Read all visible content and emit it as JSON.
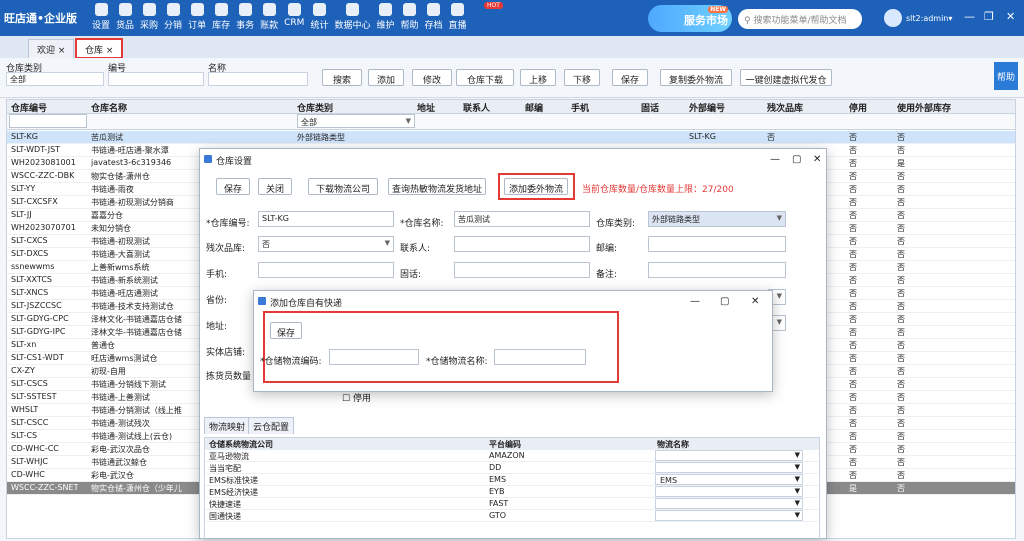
{
  "app": {
    "logo": "旺店通•企业版",
    "hot_badge": "HOT",
    "service": {
      "text": "服务市场",
      "badge": "NEW"
    },
    "search_placeholder": "搜索功能菜单/帮助文档",
    "user": "slt2:admin"
  },
  "menu": [
    "设置",
    "货品",
    "采购",
    "分销",
    "订单",
    "库存",
    "事务",
    "账款",
    "CRM",
    "统计",
    "数据中心",
    "维护",
    "帮助",
    "存档",
    "直播"
  ],
  "tabs": [
    "欢迎",
    "仓库"
  ],
  "filters": {
    "type_label": "仓库类别",
    "type_value": "全部",
    "code_label": "编号",
    "name_label": "名称"
  },
  "toolbar": [
    "搜索",
    "添加",
    "修改",
    "仓库下载",
    "上移",
    "下移",
    "保存",
    "复制委外物流",
    "一键创建虚拟代发仓"
  ],
  "help": "帮助",
  "columns": [
    "仓库编号",
    "仓库名称",
    "仓库类别",
    "地址",
    "联系人",
    "邮编",
    "手机",
    "固话",
    "外部编号",
    "残次品库",
    "停用",
    "使用外部库存"
  ],
  "grid_filter_type": "全部",
  "rows": [
    [
      "SLT-KG",
      "苦瓜测试",
      "外部链路类型",
      "SLT-KG",
      "否",
      "否",
      "否"
    ],
    [
      "SLT-WDT-JST",
      "书链通-旺店通-聚水潭",
      "",
      "",
      "",
      "否",
      "否"
    ],
    [
      "WH2023081001",
      "javatest3-6c319346",
      "",
      "",
      "",
      "否",
      "是"
    ],
    [
      "WSCC-ZZC-DBK",
      "物实仓储-潇州仓",
      "",
      "",
      "",
      "否",
      "否"
    ],
    [
      "SLT-YY",
      "书链通-雨夜",
      "",
      "",
      "",
      "否",
      "否"
    ],
    [
      "SLT-CXCSFX",
      "书链通-初现测试分销商",
      "",
      "",
      "",
      "否",
      "否"
    ],
    [
      "SLT-JJ",
      "嘉嘉分仓",
      "",
      "",
      "",
      "否",
      "否"
    ],
    [
      "WH2023070701",
      "未知分销仓",
      "",
      "",
      "",
      "否",
      "否"
    ],
    [
      "SLT-CXCS",
      "书链通-初现测试",
      "",
      "",
      "",
      "否",
      "否"
    ],
    [
      "SLT-DXCS",
      "书链通-大喜测试",
      "",
      "",
      "",
      "否",
      "否"
    ],
    [
      "ssnewwms",
      "上善新wms系统",
      "",
      "",
      "",
      "否",
      "否"
    ],
    [
      "SLT-XXTCS",
      "书链通-新系统测试",
      "",
      "",
      "",
      "否",
      "否"
    ],
    [
      "SLT-XNCS",
      "书链通-旺店通测试",
      "",
      "",
      "",
      "否",
      "否"
    ],
    [
      "SLT-JSZCCSC",
      "书链通-技术支持测试仓",
      "",
      "",
      "",
      "否",
      "否"
    ],
    [
      "SLT-GDYG-CPC",
      "泽林文化-书链通嘉店仓储",
      "",
      "",
      "",
      "否",
      "否"
    ],
    [
      "SLT-GDYG-IPC",
      "泽林文华-书链通嘉店仓储",
      "",
      "",
      "",
      "否",
      "否"
    ],
    [
      "SLT-xn",
      "普通仓",
      "",
      "",
      "",
      "否",
      "否"
    ],
    [
      "SLT-CS1-WDT",
      "旺店通wms测试仓",
      "",
      "",
      "",
      "否",
      "否"
    ],
    [
      "CX-ZY",
      "初现-自用",
      "",
      "",
      "",
      "否",
      "否"
    ],
    [
      "SLT-CSCS",
      "书链通-分销线下测试",
      "",
      "",
      "",
      "否",
      "否"
    ],
    [
      "SLT-SSTEST",
      "书链通-上善测试",
      "",
      "",
      "",
      "否",
      "否"
    ],
    [
      "WHSLT",
      "书链通-分销测试（线上推",
      "",
      "",
      "",
      "否",
      "否"
    ],
    [
      "SLT-CSCC",
      "书链通-测试残次",
      "",
      "",
      "",
      "否",
      "否"
    ],
    [
      "SLT-CS",
      "书链通-测试线上(云仓)",
      "",
      "",
      "",
      "否",
      "否"
    ],
    [
      "CD-WHC-CC",
      "彩电-武汉次品仓",
      "",
      "",
      "",
      "否",
      "否"
    ],
    [
      "SLT-WHJC",
      "书链通武汉鲸仓",
      "",
      "",
      "",
      "否",
      "否"
    ],
    [
      "CD-WHC",
      "彩电-武汉仓",
      "",
      "",
      "",
      "否",
      "否"
    ],
    [
      "WSCC-ZZC-SNET",
      "物实仓储-潇州仓（少年儿",
      "",
      "",
      "",
      "是",
      "否"
    ]
  ],
  "dialog1": {
    "title": "仓库设置",
    "buttons": [
      "保存",
      "关闭",
      "下载物流公司",
      "查询热敏物流发货地址",
      "添加委外物流"
    ],
    "warn": "当前仓库数量/仓库数量上限：27/200",
    "code_label": "*仓库编号:",
    "code_value": "SLT-KG",
    "name_label": "*仓库名称:",
    "name_value": "苦瓜测试",
    "type_label": "仓库类别:",
    "type_value": "外部链路类型",
    "defect_label": "残次品库:",
    "defect_value": "否",
    "contact_label": "联系人:",
    "zip_label": "邮编:",
    "mobile_label": "手机:",
    "phone_label": "固话:",
    "remark_label": "备注:",
    "province_label": "省份:",
    "address_label": "地址:",
    "store_label": "实体店铺:",
    "picker_label": "拣货员数量",
    "disable_label": "停用",
    "subtabs": [
      "物流映射",
      "云仓配置"
    ],
    "lm_headers": [
      "仓储系统物流公司",
      "平台编码",
      "物流名称"
    ],
    "lm_rows": [
      [
        "亚马逊物流",
        "AMAZON",
        ""
      ],
      [
        "当当宅配",
        "DD",
        ""
      ],
      [
        "EMS标准快递",
        "EMS",
        "EMS"
      ],
      [
        "EMS经济快递",
        "EYB",
        ""
      ],
      [
        "快捷速递",
        "FAST",
        ""
      ],
      [
        "国通快递",
        "GTO",
        ""
      ]
    ]
  },
  "dialog2": {
    "title": "添加仓库自有快递",
    "save": "保存",
    "code_label": "*仓储物流编码:",
    "name_label": "*仓储物流名称:"
  }
}
